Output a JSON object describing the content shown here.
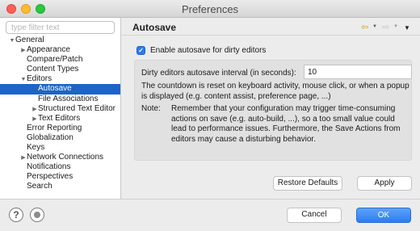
{
  "window": {
    "title": "Preferences"
  },
  "filter": {
    "placeholder": "type filter text"
  },
  "tree": [
    {
      "label": "General",
      "level": 0,
      "arrow": "open"
    },
    {
      "label": "Appearance",
      "level": 1,
      "arrow": "closed"
    },
    {
      "label": "Compare/Patch",
      "level": 1,
      "arrow": "none"
    },
    {
      "label": "Content Types",
      "level": 1,
      "arrow": "none"
    },
    {
      "label": "Editors",
      "level": 1,
      "arrow": "open"
    },
    {
      "label": "Autosave",
      "level": 2,
      "arrow": "none",
      "selected": true
    },
    {
      "label": "File Associations",
      "level": 2,
      "arrow": "none"
    },
    {
      "label": "Structured Text Editor",
      "level": 2,
      "arrow": "closed"
    },
    {
      "label": "Text Editors",
      "level": 2,
      "arrow": "closed"
    },
    {
      "label": "Error Reporting",
      "level": 1,
      "arrow": "none"
    },
    {
      "label": "Globalization",
      "level": 1,
      "arrow": "none"
    },
    {
      "label": "Keys",
      "level": 1,
      "arrow": "none"
    },
    {
      "label": "Network Connections",
      "level": 1,
      "arrow": "closed"
    },
    {
      "label": "Notifications",
      "level": 1,
      "arrow": "none"
    },
    {
      "label": "Perspectives",
      "level": 1,
      "arrow": "none"
    },
    {
      "label": "Search",
      "level": 1,
      "arrow": "none"
    }
  ],
  "page": {
    "title": "Autosave",
    "enable_label": "Enable autosave for dirty editors",
    "enable_checked": true,
    "interval_label": "Dirty editors autosave interval (in seconds):",
    "interval_value": "10",
    "countdown_text": "The countdown is reset on keyboard activity, mouse click, or when a popup is displayed (e.g. content assist, preference page, ...)",
    "note_label": "Note:",
    "note_text": "Remember that your configuration may trigger time-consuming actions on save (e.g. auto-build, ...), so a too small value could lead to performance issues. Furthermore, the Save Actions from editors may cause a disturbing behavior.",
    "restore_label": "Restore Defaults",
    "apply_label": "Apply"
  },
  "nav_icons": [
    "back-arrow-icon",
    "dropdown-icon",
    "forward-arrow-icon",
    "dropdown-icon",
    "view-menu-icon"
  ],
  "footer": {
    "help_icon": "?",
    "cancel_label": "Cancel",
    "ok_label": "OK"
  },
  "colors": {
    "selection": "#1e63c7",
    "ok_button": "#2c7df2",
    "back_arrow": "#d9a21a"
  }
}
